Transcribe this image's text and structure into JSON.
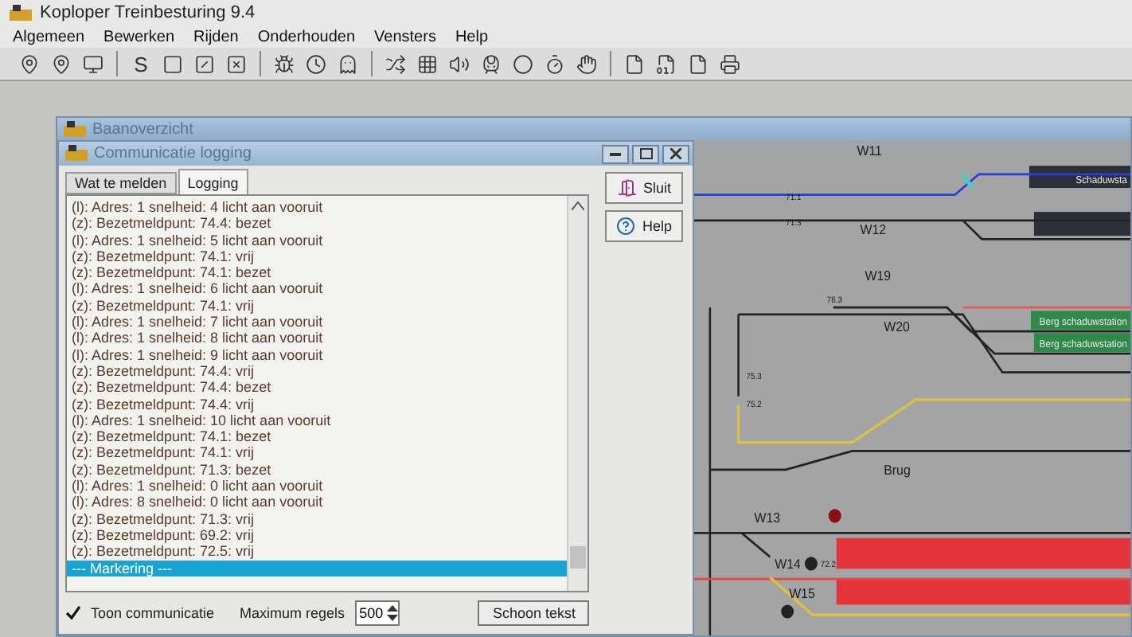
{
  "window": {
    "title": "Koploper Treinbesturing 9.4"
  },
  "menu": [
    "Algemeen",
    "Bewerken",
    "Rijden",
    "Onderhouden",
    "Vensters",
    "Help"
  ],
  "toolbar": {
    "letter": "S"
  },
  "track_window": {
    "title": "Baanoverzicht"
  },
  "logging_window": {
    "title": "Communicatie logging",
    "tabs": [
      {
        "label": "Wat te melden",
        "selected": false
      },
      {
        "label": "Logging",
        "selected": true
      }
    ],
    "lines": [
      {
        "text": "(l): Adres: 1 snelheid: 4 licht aan vooruit",
        "selected": false
      },
      {
        "text": "(z): Bezetmeldpunt: 74.4: bezet",
        "selected": false
      },
      {
        "text": "(l): Adres: 1 snelheid: 5 licht aan vooruit",
        "selected": false
      },
      {
        "text": "(z): Bezetmeldpunt: 74.1: vrij",
        "selected": false
      },
      {
        "text": "(z): Bezetmeldpunt: 74.1: bezet",
        "selected": false
      },
      {
        "text": "(l): Adres: 1 snelheid: 6 licht aan vooruit",
        "selected": false
      },
      {
        "text": "(z): Bezetmeldpunt: 74.1: vrij",
        "selected": false
      },
      {
        "text": "(l): Adres: 1 snelheid: 7 licht aan vooruit",
        "selected": false
      },
      {
        "text": "(l): Adres: 1 snelheid: 8 licht aan vooruit",
        "selected": false
      },
      {
        "text": "(l): Adres: 1 snelheid: 9 licht aan vooruit",
        "selected": false
      },
      {
        "text": "(z): Bezetmeldpunt: 74.4: vrij",
        "selected": false
      },
      {
        "text": "(z): Bezetmeldpunt: 74.4: bezet",
        "selected": false
      },
      {
        "text": "(z): Bezetmeldpunt: 74.4: vrij",
        "selected": false
      },
      {
        "text": "(l): Adres: 1 snelheid: 10 licht aan vooruit",
        "selected": false
      },
      {
        "text": "(z): Bezetmeldpunt: 74.1: bezet",
        "selected": false
      },
      {
        "text": "(z): Bezetmeldpunt: 74.1: vrij",
        "selected": false
      },
      {
        "text": "(z): Bezetmeldpunt: 71.3: bezet",
        "selected": false
      },
      {
        "text": "(l): Adres: 1 snelheid: 0 licht aan vooruit",
        "selected": false
      },
      {
        "text": "(l): Adres: 8 snelheid: 0 licht aan vooruit",
        "selected": false
      },
      {
        "text": "(z): Bezetmeldpunt: 71.3: vrij",
        "selected": false
      },
      {
        "text": "(z): Bezetmeldpunt: 69.2: vrij",
        "selected": false
      },
      {
        "text": "(z): Bezetmeldpunt: 72.5: vrij",
        "selected": false
      },
      {
        "text": "--- Markering ---",
        "selected": true
      }
    ],
    "buttons": [
      {
        "label": "Sluit",
        "kind": "close"
      },
      {
        "label": "Help",
        "kind": "help"
      }
    ],
    "show_communication": {
      "label": "Toon communicatie",
      "checked": true
    },
    "max_lines": {
      "label": "Maximum regels",
      "value": "500"
    },
    "clear_button": "Schoon tekst"
  },
  "track_diagram": {
    "labels": [
      "W11",
      "71.1",
      "71.3",
      "W12",
      "W19",
      "76.3",
      "W20",
      "75.3",
      "75.2",
      "Brug",
      "W13",
      "W14",
      "72.2",
      "W15"
    ],
    "blocks": [
      {
        "label": "Schaduwsta",
        "kind": "dark"
      },
      {
        "kind": "dark"
      },
      {
        "label": "Berg schaduwstation",
        "kind": "green"
      },
      {
        "label": "Berg schaduwstation",
        "kind": "green"
      },
      {
        "kind": "red"
      },
      {
        "kind": "red"
      }
    ]
  }
}
